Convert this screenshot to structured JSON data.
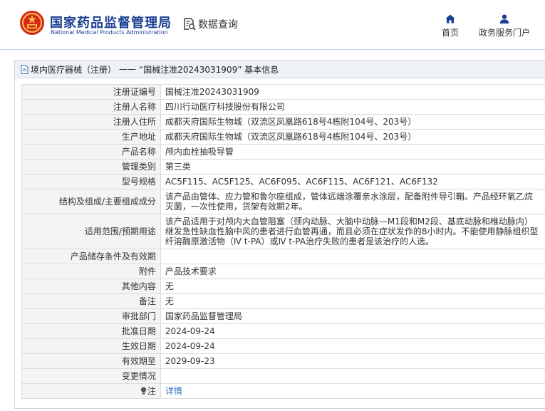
{
  "header": {
    "org_name_cn": "国家药品监督管理局",
    "org_name_en": "National Medical Products Administration",
    "data_query": "数据查询",
    "nav": {
      "home": "首页",
      "portal": "政务服务门户"
    }
  },
  "breadcrumb": {
    "category": "境内医疗器械（注册）",
    "separator": "——",
    "title": "“国械注准20243031909” 基本信息"
  },
  "details": {
    "rows": [
      {
        "label": "注册证编号",
        "value": "国械注准20243031909"
      },
      {
        "label": "注册人名称",
        "value": "四川行动医疗科技股份有限公司"
      },
      {
        "label": "注册人住所",
        "value": "成都天府国际生物城（双流区凤凰路618号4栋附104号、203号）"
      },
      {
        "label": "生产地址",
        "value": "成都天府国际生物城（双流区凤凰路618号4栋附104号、203号）"
      },
      {
        "label": "产品名称",
        "value": "颅内血栓抽吸导管"
      },
      {
        "label": "管理类别",
        "value": "第三类"
      },
      {
        "label": "型号规格",
        "value": "AC5F115、AC5F125、AC6F095、AC6F115、AC6F121、AC6F132"
      },
      {
        "label": "结构及组成/主要组成成分",
        "value": "该产品由管体、应力管和鲁尔座组成，管体远端涂覆亲水涂层，配备附件导引鞘。产品经环氧乙烷灭菌，一次性使用，货架有效期2年。"
      },
      {
        "label": "适用范围/预期用途",
        "value": "该产品适用于对颅内大血管阻塞（颈内动脉、大脑中动脉—M1段和M2段、基底动脉和椎动脉内）继发急性缺血性脑中风的患者进行血管再通，而且必须在症状发作的8小时内。不能使用静脉组织型纤溶酶原激活物（Ⅳ t-PA）或Ⅳ t-PA治疗失败的患者是该治疗的人选。"
      },
      {
        "label": "产品储存条件及有效期",
        "value": ""
      },
      {
        "label": "附件",
        "value": "产品技术要求"
      },
      {
        "label": "其他内容",
        "value": "无"
      },
      {
        "label": "备注",
        "value": "无"
      },
      {
        "label": "审批部门",
        "value": "国家药品监督管理局"
      },
      {
        "label": "批准日期",
        "value": "2024-09-24"
      },
      {
        "label": "生效日期",
        "value": "2024-09-24"
      },
      {
        "label": "有效期至",
        "value": "2029-09-23"
      },
      {
        "label": "变更情况",
        "value": ""
      },
      {
        "label": "注",
        "value": "详情"
      }
    ]
  },
  "colors": {
    "brand_blue": "#1b3f92",
    "link_blue": "#2a6ebb",
    "label_bg": "#f4f4f4",
    "emblem_red": "#d7261e"
  },
  "icons": {
    "logo": "national-emblem-icon",
    "query": "search-document-icon",
    "home": "home-icon",
    "portal": "user-icon",
    "breadcrumb": "document-icon",
    "note": "lightbulb-icon"
  }
}
